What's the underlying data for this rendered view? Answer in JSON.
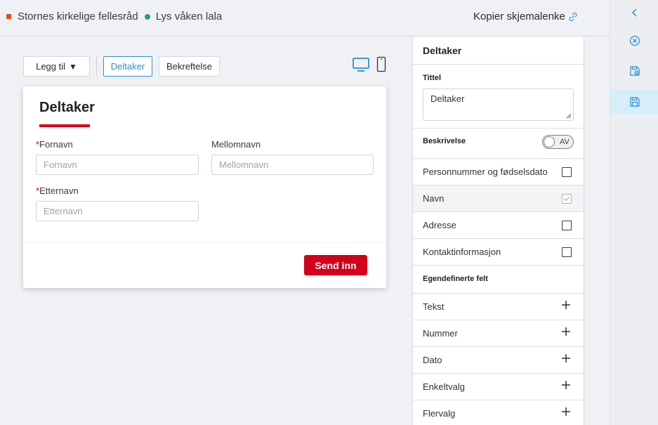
{
  "header": {
    "org_name": "Stornes kirkelige fellesråd",
    "form_name": "Lys våken lala",
    "copy_link_label": "Kopier skjemalenke"
  },
  "toolbar": {
    "add_label": "Legg til",
    "tabs": [
      "Deltaker",
      "Bekreftelse"
    ],
    "active_tab": "Deltaker"
  },
  "form": {
    "title": "Deltaker",
    "fields": [
      {
        "label": "Fornavn",
        "placeholder": "Fornavn",
        "required": true
      },
      {
        "label": "Mellomnavn",
        "placeholder": "Mellomnavn",
        "required": false
      },
      {
        "label": "Etternavn",
        "placeholder": "Etternavn",
        "required": true
      }
    ],
    "required_marker": "*",
    "submit_label": "Send inn"
  },
  "panel": {
    "title": "Deltaker",
    "title_field_label": "Tittel",
    "title_field_value": "Deltaker",
    "description_label": "Beskrivelse",
    "description_toggle": "AV",
    "options": [
      {
        "label": "Personnummer og fødselsdato",
        "checked": false
      },
      {
        "label": "Navn",
        "checked": true
      },
      {
        "label": "Adresse",
        "checked": false
      },
      {
        "label": "Kontaktinformasjon",
        "checked": false
      }
    ],
    "custom_fields_label": "Egendefinerte felt",
    "custom_fields": [
      "Tekst",
      "Nummer",
      "Dato",
      "Enkeltvalg",
      "Flervalg"
    ]
  },
  "colors": {
    "accent_red": "#d4001a",
    "accent_blue": "#2d8fd5",
    "teal": "#1e9e90",
    "orange": "#e0501b"
  },
  "icons": {
    "rail": [
      "chevron-left-icon",
      "close-circle-icon",
      "save-as-icon",
      "save-icon"
    ]
  }
}
